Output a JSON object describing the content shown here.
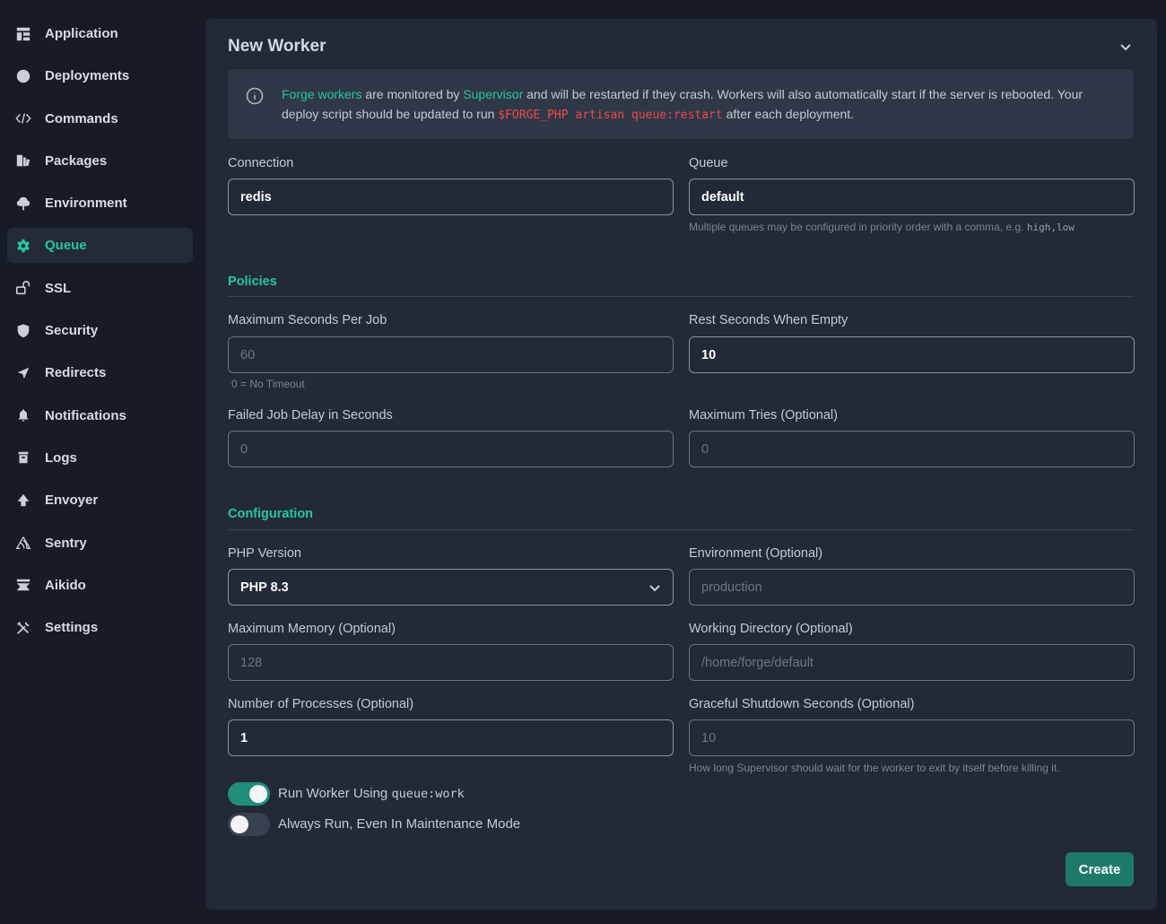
{
  "sidebar": {
    "items": [
      {
        "label": "Application",
        "icon": "layout-icon"
      },
      {
        "label": "Deployments",
        "icon": "clock-icon"
      },
      {
        "label": "Commands",
        "icon": "code-icon"
      },
      {
        "label": "Packages",
        "icon": "packages-icon"
      },
      {
        "label": "Environment",
        "icon": "tree-icon"
      },
      {
        "label": "Queue",
        "icon": "gear-icon",
        "active": true
      },
      {
        "label": "SSL",
        "icon": "unlock-icon"
      },
      {
        "label": "Security",
        "icon": "shield-icon"
      },
      {
        "label": "Redirects",
        "icon": "send-icon"
      },
      {
        "label": "Notifications",
        "icon": "bell-icon"
      },
      {
        "label": "Logs",
        "icon": "archive-icon"
      },
      {
        "label": "Envoyer",
        "icon": "envoyer-icon"
      },
      {
        "label": "Sentry",
        "icon": "sentry-icon"
      },
      {
        "label": "Aikido",
        "icon": "aikido-icon"
      },
      {
        "label": "Settings",
        "icon": "tools-icon"
      }
    ]
  },
  "panel": {
    "title": "New Worker",
    "info": {
      "link1": "Forge workers",
      "text1": " are monitored by ",
      "link2": "Supervisor",
      "text2": " and will be restarted if they crash. Workers will also automatically start if the server is rebooted. Your deploy script should be updated to run ",
      "code": "$FORGE_PHP artisan queue:restart",
      "text3": " after each deployment."
    },
    "connection": {
      "label": "Connection",
      "value": "redis"
    },
    "queue": {
      "label": "Queue",
      "value": "default",
      "hint": "Multiple queues may be configured in priority order with a comma, e.g. ",
      "hint_code": "high,low"
    },
    "policies": {
      "title": "Policies",
      "max_seconds": {
        "label": "Maximum Seconds Per Job",
        "placeholder": "60",
        "hint": "0 = No Timeout"
      },
      "rest_seconds": {
        "label": "Rest Seconds When Empty",
        "value": "10"
      },
      "failed_delay": {
        "label": "Failed Job Delay in Seconds",
        "placeholder": "0"
      },
      "max_tries": {
        "label": "Maximum Tries (Optional)",
        "placeholder": "0"
      }
    },
    "configuration": {
      "title": "Configuration",
      "php_version": {
        "label": "PHP Version",
        "value": "PHP 8.3"
      },
      "environment": {
        "label": "Environment (Optional)",
        "placeholder": "production"
      },
      "max_memory": {
        "label": "Maximum Memory (Optional)",
        "placeholder": "128"
      },
      "working_dir": {
        "label": "Working Directory (Optional)",
        "placeholder": "/home/forge/default"
      },
      "processes": {
        "label": "Number of Processes (Optional)",
        "value": "1"
      },
      "graceful": {
        "label": "Graceful Shutdown Seconds (Optional)",
        "placeholder": "10",
        "hint": "How long Supervisor should wait for the worker to exit by itself before killing it."
      }
    },
    "toggles": {
      "queue_work": {
        "label": "Run Worker Using ",
        "code": "queue:work",
        "on": true
      },
      "maintenance": {
        "label": "Always Run, Even In Maintenance Mode",
        "on": false
      }
    },
    "create_label": "Create"
  },
  "colors": {
    "accent": "#27c6a0",
    "panel": "#222a37",
    "background": "#161b26",
    "button": "#1e7a68",
    "code": "#f0484e"
  }
}
